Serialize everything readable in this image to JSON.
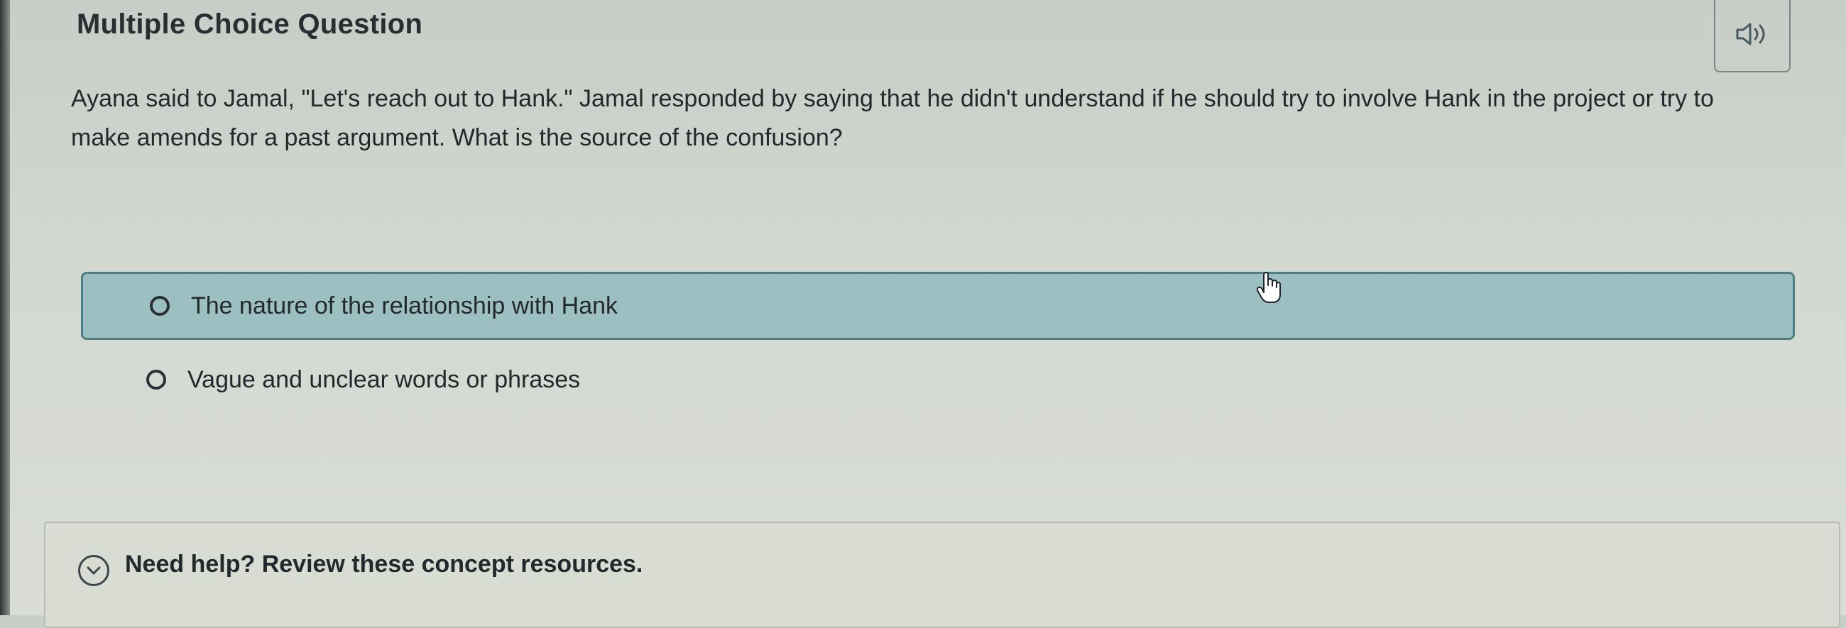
{
  "header": {
    "title": "Multiple Choice Question",
    "audio_icon": "speaker-icon"
  },
  "question": {
    "text": "Ayana said to Jamal, \"Let's reach out to Hank.\" Jamal responded by saying that he didn't understand if he should try to involve Hank in the project or try to make amends for a past argument. What is the source of the confusion?"
  },
  "choices": [
    {
      "label": "The nature of the relationship with Hank",
      "state": "hovered"
    },
    {
      "label": "Vague and unclear words or phrases",
      "state": "default"
    }
  ],
  "help": {
    "label": "Need help? Review these concept resources.",
    "icon": "chevron-down-circle-icon"
  },
  "colors": {
    "hover_background": "#9cbfc1",
    "hover_border": "#4f7f86",
    "text": "#23282c"
  }
}
